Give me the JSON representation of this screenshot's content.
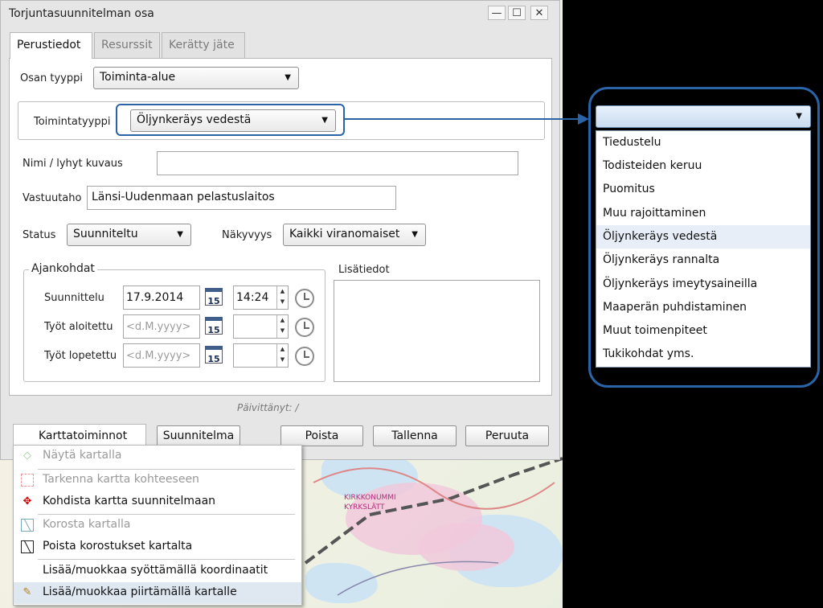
{
  "dialog": {
    "title": "Torjuntasuunnitelman osa",
    "window_buttons": {
      "minimize": "—",
      "maximize": "☐",
      "close": "✕"
    },
    "tabs": [
      "Perustiedot",
      "Resurssit",
      "Kerätty jäte"
    ],
    "active_tab": "Perustiedot",
    "osan_tyyppi": {
      "label": "Osan tyyppi",
      "value": "Toiminta-alue"
    },
    "toimintatyyppi": {
      "label": "Toimintatyyppi",
      "value": "Öljynkeräys vedestä"
    },
    "nimi": {
      "label": "Nimi / lyhyt kuvaus",
      "value": ""
    },
    "vastuutaho": {
      "label": "Vastuutaho",
      "value": "Länsi-Uudenmaan pelastuslaitos"
    },
    "status": {
      "label": "Status",
      "value": "Suunniteltu"
    },
    "nakyvyys": {
      "label": "Näkyvyys",
      "value": "Kaikki viranomaiset"
    },
    "ajankohdat": {
      "legend": "Ajankohdat",
      "calendar_day": "15",
      "rows": [
        {
          "label": "Suunnittelu",
          "date": "17.9.2014",
          "time": "14:24"
        },
        {
          "label": "Työt aloitettu",
          "date": "",
          "time": ""
        },
        {
          "label": "Työt lopetettu",
          "date": "",
          "time": ""
        }
      ],
      "date_placeholder": "<d.M.yyyy>"
    },
    "lisatiedot": {
      "label": "Lisätiedot"
    },
    "paivittanyt": "Päivittänyt: /",
    "buttons": {
      "karttatoiminnot": "Karttatoiminnot",
      "suunnitelma": "Suunnitelma",
      "poista": "Poista",
      "tallenna": "Tallenna",
      "peruuta": "Peruuta"
    }
  },
  "dropdown": {
    "selected": "Öljynkeräys vedestä",
    "options": [
      "Tiedustelu",
      "Todisteiden keruu",
      "Puomitus",
      "Muu rajoittaminen",
      "Öljynkeräys vedestä",
      "Öljynkeräys rannalta",
      "Öljynkeräys imeytysaineilla",
      "Maaperän puhdistaminen",
      "Muut toimenpiteet",
      "Tukikohdat yms."
    ]
  },
  "context_menu": {
    "items": [
      {
        "label": "Näytä kartalla",
        "icon": "show-on-map-icon",
        "enabled": false
      },
      {
        "label": "Tarkenna kartta kohteeseen",
        "icon": "zoom-to-target-icon",
        "enabled": false
      },
      {
        "label": "Kohdista kartta suunnitelmaan",
        "icon": "focus-plan-icon",
        "enabled": true
      },
      {
        "label": "Korosta kartalla",
        "icon": "highlight-icon",
        "enabled": false
      },
      {
        "label": "Poista korostukset kartalta",
        "icon": "remove-highlight-icon",
        "enabled": true
      },
      {
        "label": "Lisää/muokkaa syöttämällä koordinaatit",
        "icon": "",
        "enabled": true
      },
      {
        "label": "Lisää/muokkaa piirtämällä kartalle",
        "icon": "pencil-icon",
        "enabled": true
      }
    ]
  },
  "map": {
    "labels": [
      "KIRKKONUMMI",
      "KYRKSLÄTT"
    ]
  },
  "colors": {
    "accent": "#2a64a6",
    "dialog_bg": "#e6e6e6",
    "highlight": "#e7eef7"
  }
}
